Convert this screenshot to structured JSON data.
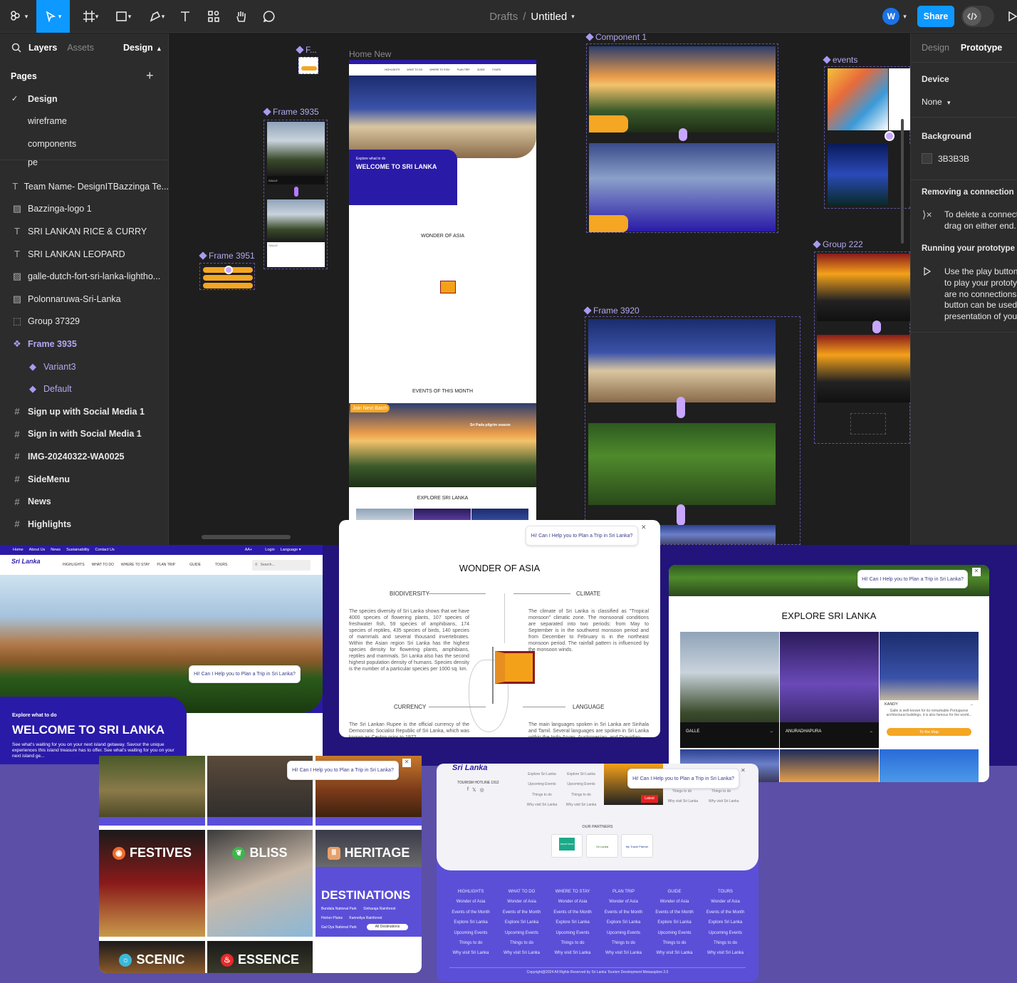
{
  "toolbar": {
    "breadcrumb_root": "Drafts",
    "breadcrumb_sep": "/",
    "file_name": "Untitled",
    "avatar_letter": "W",
    "share_label": "Share"
  },
  "left_panel": {
    "tabs": [
      "Layers",
      "Assets"
    ],
    "design_dropdown": "Design",
    "pages_title": "Pages",
    "pages": [
      "Design",
      "wireframe",
      "components"
    ],
    "partial_layer": "pe",
    "layers": [
      {
        "icon": "text-icon",
        "label": "Team Name- DesignITBazzinga Te..."
      },
      {
        "icon": "image-icon",
        "label": "Bazzinga-logo 1"
      },
      {
        "icon": "text-icon",
        "label": "SRI LANKAN RICE & CURRY"
      },
      {
        "icon": "text-icon",
        "label": "SRI LANKAN LEOPARD"
      },
      {
        "icon": "image-icon",
        "label": "galle-dutch-fort-sri-lanka-lightho..."
      },
      {
        "icon": "image-icon",
        "label": "Polonnaruwa-Sri-Lanka"
      },
      {
        "icon": "group-icon",
        "label": "Group 37329"
      },
      {
        "icon": "component-icon",
        "label": "Frame 3935"
      },
      {
        "icon": "variant-icon",
        "label": "Variant3"
      },
      {
        "icon": "variant-icon",
        "label": "Default"
      },
      {
        "icon": "frame-icon",
        "label": "Sign up with Social Media 1"
      },
      {
        "icon": "frame-icon",
        "label": "Sign in with Social Media 1"
      },
      {
        "icon": "frame-icon",
        "label": "IMG-20240322-WA0025"
      },
      {
        "icon": "frame-icon",
        "label": "SideMenu"
      },
      {
        "icon": "frame-icon",
        "label": "News"
      },
      {
        "icon": "frame-icon",
        "label": "Highlights"
      }
    ]
  },
  "right_panel": {
    "tabs": [
      "Design",
      "Prototype"
    ],
    "device_title": "Device",
    "device_value": "None",
    "background_title": "Background",
    "background_hex": "3B3B3B",
    "removing_title": "Removing a connection",
    "removing_text": [
      "To delete a connecti",
      "drag on either end."
    ],
    "running_title": "Running your prototype",
    "running_text": [
      "Use the play button",
      "to play your prototyp",
      "are no connections,",
      "button can be used",
      "presentation of your"
    ]
  },
  "canvas_labels": {
    "f_small": "F...",
    "frame_3935": "Frame 3935",
    "frame_3951": "Frame 3951",
    "home_new": "Home New",
    "component_1": "Component 1",
    "events": "events",
    "frame_3920": "Frame 3920",
    "group_222": "Group 222"
  },
  "home_preview": {
    "nav": [
      "HIGHLIGHTS",
      "WHAT TO DO",
      "WHERE TO STAY",
      "PLAN TRIP",
      "GUIDE",
      "TOURS"
    ],
    "explore_small": "Explore what to do",
    "welcome": "WELCOME TO SRI LANKA",
    "wonder": "WONDER OF ASIA",
    "events_title": "EVENTS OF THIS MONTH",
    "explore_title": "EXPLORE SRI LANKA",
    "join_batch": "Join Next Batch",
    "sri_pada": "Sri Pada pilgrim season"
  },
  "card_home": {
    "topnav": [
      "Home",
      "About Us",
      "News",
      "Sustainability",
      "Contact Us"
    ],
    "topnav_right": [
      "AA+",
      "Login",
      "Language ▾"
    ],
    "logo_text": "Sri Lanka",
    "nav": [
      "HIGHLIGHTS",
      "WHAT TO DO",
      "WHERE TO STAY",
      "PLAN TRIP",
      "GUIDE",
      "TOURS"
    ],
    "search_placeholder": "Search...",
    "chat": "Hi! Can I Help you to Plan a Trip in Sri Lanka?",
    "explore_small": "Explore what to do",
    "welcome": "WELCOME TO SRI LANKA",
    "desc": "See what's waiting for you on your next island getaway. Savour the unique experiences this island treasure has to offer. See what's waiting for you on your next island ge..."
  },
  "card_wonder": {
    "chat": "Hi! Can I Help you to Plan a Trip in Sri Lanka?",
    "title": "WONDER OF ASIA",
    "biodiversity": "BIODIVERSITY",
    "climate": "CLIMATE",
    "currency": "CURRENCY",
    "language": "LANGUAGE",
    "bio_text": "The species diversity of Sri Lanka shows that we have 4000 species of flowering plants, 107 species of freshwater fish, 59 species of amphibians, 174 species of reptiles, 435 species of birds, 140 species of mammals and several thousand invertebrates. Within the Asian region Sri Lanka has the highest species density for flowering plants, amphibians, reptiles and mammals. Sri Lanka also has the second highest population density of humans. Species density is the number of a particular species per 1000 sq. km.",
    "climate_text": "The climate of Sri Lanka is classified as \"Tropical monsoon\" climatic zone. The monsoonal conditions are separated into two periods: from May to September is in the southwest monsoon period and from December to February is in the northeast monsoon period. The rainfall pattern is influenced by the monsoon winds.",
    "currency_text": "The Sri Lankan Rupee is the official currency of the Democratic Socialist Republic of Sri Lanka, which was known as Ceylon prior to 1972.",
    "language_text": "The main languages spoken in Sri Lanka are Sinhala and Tamil. Several languages are spoken in Sri Lanka within the Indo-Aryan, Austronesian, and Dravidian"
  },
  "card_explore": {
    "chat": "Hi! Can I Help you to Plan a Trip in Sri Lanka?",
    "title": "EXPLORE SRI LANKA",
    "tiles": [
      "GALLE",
      "ANURADHAPURA",
      "KANDY"
    ],
    "kandy_desc": "Galle is well-known for its remarkable Portuguese architectural buildings, it is also famous for the world...",
    "map_button": "To the Map"
  },
  "card_experiences": {
    "chat": "Hi! Can I Help you to Plan a Trip in Sri Lanka?",
    "tiles": [
      "FESTIVES",
      "BLISS",
      "HERITAGE",
      "SCENIC",
      "ESSENCE"
    ],
    "destinations": "DESTINATIONS",
    "dest_links": [
      "Bundala National Park",
      "Sinharaja Rainforest",
      "Horton Plains",
      "Kanneliya Rainforest",
      "Gal Oya National Park"
    ],
    "all_dest": "All Destinations"
  },
  "card_footer": {
    "logo_text": "Sri Lanka",
    "hotline": "TOURISM HOTLINE 1912",
    "chat": "Hi! Can I Help you to Plan a Trip in Sri Lanka?",
    "latest": "Latest",
    "top_links": [
      "Explore Sri Lanka",
      "Upcoming Events",
      "Things to do",
      "Why visit Sri Lanka"
    ],
    "partners_title": "OUR PARTNERS",
    "partners": [
      "travel lecci",
      "Sri Lanka",
      "My Travel Partner"
    ],
    "columns": [
      "HIGHLIGHTS",
      "WHAT TO DO",
      "WHERE TO STAY",
      "PLAN TRIP",
      "GUIDE",
      "TOURS"
    ],
    "col_links": [
      "Wonder of Asia",
      "Events of the Month",
      "Explore Sri Lanka",
      "Upcoming Events",
      "Things to do",
      "Why visit Sri Lanka"
    ],
    "copyright": "Copyright@2024 All Rights Reserved by Sri Lanka Tourism Development Motausplore 2.0"
  },
  "colors": {
    "figma_bg": "#1e1e1e",
    "panel": "#2c2c2c",
    "share_blue": "#0d99ff",
    "accent_purple": "#5b4fa8",
    "brand_indigo": "#2a1aa8",
    "brand_orange": "#f5a623"
  }
}
